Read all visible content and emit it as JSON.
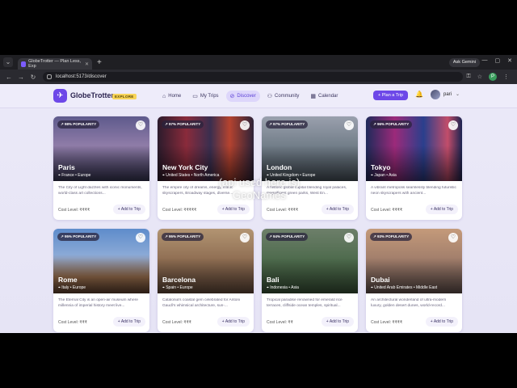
{
  "browser": {
    "tab_title": "GlobeTrotter — Plan Less, Exp",
    "gemini_label": "Ask Gemini",
    "url": "localhost:5173/discover",
    "profile_initial": "P"
  },
  "nav": {
    "brand": "GlobeTrotter",
    "badge": "EXPLORE",
    "links": [
      {
        "label": "Home",
        "icon": "home-icon"
      },
      {
        "label": "My Trips",
        "icon": "book-icon"
      },
      {
        "label": "Discover",
        "icon": "compass-icon",
        "active": true
      },
      {
        "label": "Community",
        "icon": "people-icon"
      },
      {
        "label": "Calendar",
        "icon": "calendar-icon"
      }
    ],
    "plan_button": "+ Plan a Trip",
    "user_name": "pari"
  },
  "cards": [
    {
      "popularity": "98% POPULARITY",
      "city": "Paris",
      "location": "France • Europe",
      "description": "The City of Light dazzles with iconic monuments, world-class art collections...",
      "cost_label": "Cost Level:",
      "cost": "₹₹₹₹",
      "button": "+ Add to Trip"
    },
    {
      "popularity": "97% POPULARITY",
      "city": "New York City",
      "location": "United States • North America",
      "description": "The empire city of dreams, energy, iconic skyscrapers, Broadway stages, diverse...",
      "cost_label": "Cost Level:",
      "cost": "₹₹₹₹₹",
      "button": "+ Add to Trip"
    },
    {
      "popularity": "97% POPULARITY",
      "city": "London",
      "location": "United Kingdom • Europe",
      "description": "A historic global capital blending royal palaces, magnificent green parks, West En...",
      "cost_label": "Cost Level:",
      "cost": "₹₹₹₹",
      "button": "+ Add to Trip"
    },
    {
      "popularity": "96% POPULARITY",
      "city": "Tokyo",
      "location": "Japan • Asia",
      "description": "A vibrant metropolis seamlessly blending futuristic neon skyscrapers with ancient...",
      "cost_label": "Cost Level:",
      "cost": "₹₹₹₹",
      "button": "+ Add to Trip"
    },
    {
      "popularity": "95% POPULARITY",
      "city": "Rome",
      "location": "Italy • Europe",
      "description": "The Eternal City is an open-air museum where millennia of imperial history meet live...",
      "cost_label": "Cost Level:",
      "cost": "₹₹₹",
      "button": "+ Add to Trip"
    },
    {
      "popularity": "95% POPULARITY",
      "city": "Barcelona",
      "location": "Spain • Europe",
      "description": "Catalonia's coastal gem celebrated for Antoni Gaudí's whimsical architecture, sun-...",
      "cost_label": "Cost Level:",
      "cost": "₹₹₹",
      "button": "+ Add to Trip"
    },
    {
      "popularity": "94% POPULARITY",
      "city": "Bali",
      "location": "Indonesia • Asia",
      "description": "Tropical paradise renowned for emerald rice terraces, cliffside ocean temples, spiritual...",
      "cost_label": "Cost Level:",
      "cost": "₹₹",
      "button": "+ Add to Trip"
    },
    {
      "popularity": "93% POPULARITY",
      "city": "Dubai",
      "location": "United Arab Emirates • Middle East",
      "description": "An architectural wonderland of ultra-modern luxury, golden desert dunes, world-record...",
      "cost_label": "Cost Level:",
      "cost": "₹₹₹₹",
      "button": "+ Add to Trip"
    }
  ],
  "overlay_caption": "(api used here is) GeoNames"
}
